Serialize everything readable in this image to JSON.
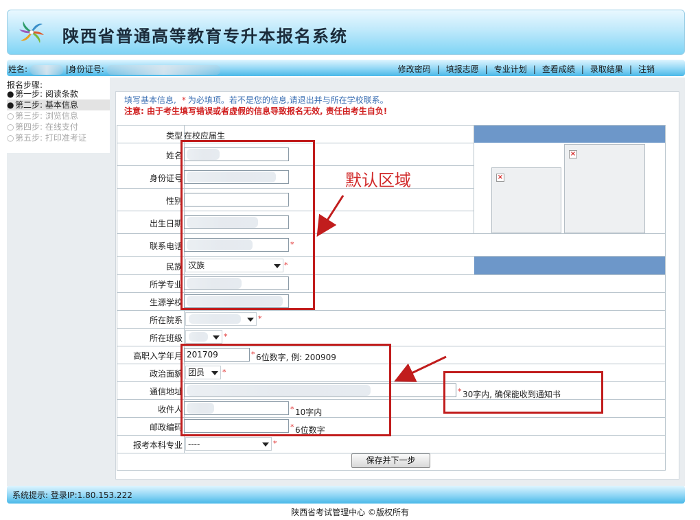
{
  "header": {
    "title": "陕西省普通高等教育专升本报名系统"
  },
  "infobar": {
    "name_label": "姓名:",
    "id_label": "|身份证号:",
    "nav": [
      "修改密码",
      "填报志愿",
      "专业计划",
      "查看成绩",
      "录取结果",
      "注销"
    ]
  },
  "steps": {
    "title": "报名步骤:",
    "items": [
      {
        "label": "第一步: 阅读条款",
        "marker": "●"
      },
      {
        "label": "第二步: 基本信息",
        "marker": "●"
      },
      {
        "label": "第三步: 浏览信息",
        "marker": "○"
      },
      {
        "label": "第四步: 在线支付",
        "marker": "○"
      },
      {
        "label": "第五步: 打印准考证",
        "marker": "○"
      }
    ]
  },
  "notice": {
    "line1_prefix": "填写基本信息,",
    "required_mark": "*",
    "line1_suffix": "为必填项。若不是您的信息,请退出并与所在学校联系。",
    "line2": "注意: 由于考生填写错误或者虚假的信息导致报名无效, 责任由考生自负!"
  },
  "form": {
    "type_label": "类型",
    "type_value": "在校应届生",
    "name_label": "姓名",
    "id_label": "身份证号",
    "gender_label": "性别",
    "birth_label": "出生日期",
    "phone_label": "联系电话",
    "ethnicity_label": "民族",
    "ethnicity_value": "汉族",
    "major_label": "所学专业",
    "school_label": "生源学校",
    "dept_label": "所在院系",
    "class_label": "所在班级",
    "enroll_label": "高职入学年月",
    "enroll_value": "201709",
    "enroll_hint": "6位数字, 例: 200909",
    "political_label": "政治面貌",
    "political_value": "团员",
    "address_label": "通信地址",
    "address_hint": "30字内, 确保能收到通知书",
    "recipient_label": "收件人",
    "recipient_hint": "10字内",
    "postcode_label": "邮政编码",
    "postcode_hint": "6位数字",
    "target_major_label": "报考本科专业",
    "target_major_value": "----",
    "required_mark": "*",
    "submit_label": "保存并下一步"
  },
  "annotation": {
    "callout": "默认区域"
  },
  "footer": {
    "system_tip": "系统提示: 登录IP:1.80.153.222",
    "copyright": "陕西省考试管理中心 ©版权所有"
  },
  "colors": {
    "accent_blue": "#4ab8e8",
    "header_blue": "#6d97c9",
    "annotation_red": "#c11d1d",
    "warning_red": "#d02020"
  }
}
